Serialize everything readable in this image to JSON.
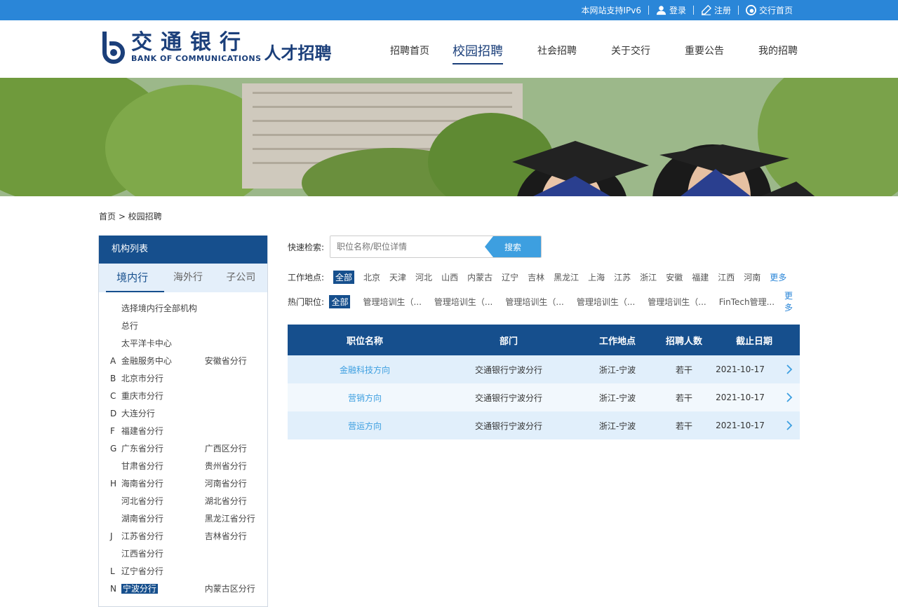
{
  "topbar": {
    "ipv6": "本网站支持IPv6",
    "login": "登录",
    "register": "注册",
    "home": "交行首页"
  },
  "brand": {
    "cn": "交通银行",
    "en": "BANK OF COMMUNICATIONS",
    "sub": "人才招聘"
  },
  "nav": [
    "招聘首页",
    "校园招聘",
    "社会招聘",
    "关于交行",
    "重要公告",
    "我的招聘"
  ],
  "breadcrumb": "首页 > 校园招聘",
  "sidebar": {
    "title": "机构列表",
    "tabs": [
      "境内行",
      "海外行",
      "子公司"
    ],
    "rows": [
      {
        "letter": "",
        "a": "选择境内行全部机构",
        "b": ""
      },
      {
        "letter": "",
        "a": "总行",
        "b": ""
      },
      {
        "letter": "",
        "a": "太平洋卡中心",
        "b": ""
      },
      {
        "letter": "A",
        "a": "金融服务中心",
        "b": "安徽省分行"
      },
      {
        "letter": "B",
        "a": "北京市分行",
        "b": ""
      },
      {
        "letter": "C",
        "a": "重庆市分行",
        "b": ""
      },
      {
        "letter": "D",
        "a": "大连分行",
        "b": ""
      },
      {
        "letter": "F",
        "a": "福建省分行",
        "b": ""
      },
      {
        "letter": "G",
        "a": "广东省分行",
        "b": "广西区分行"
      },
      {
        "letter": "",
        "a": "甘肃省分行",
        "b": "贵州省分行"
      },
      {
        "letter": "H",
        "a": "海南省分行",
        "b": "河南省分行"
      },
      {
        "letter": "",
        "a": "河北省分行",
        "b": "湖北省分行"
      },
      {
        "letter": "",
        "a": "湖南省分行",
        "b": "黑龙江省分行"
      },
      {
        "letter": "J",
        "a": "江苏省分行",
        "b": "吉林省分行"
      },
      {
        "letter": "",
        "a": "江西省分行",
        "b": ""
      },
      {
        "letter": "L",
        "a": "辽宁省分行",
        "b": ""
      },
      {
        "letter": "N",
        "a": "宁波分行",
        "b": "内蒙古区分行"
      }
    ]
  },
  "search": {
    "label": "快速检索:",
    "placeholder": "职位名称/职位详情",
    "button": "搜索"
  },
  "filters": {
    "location_label": "工作地点:",
    "locations": [
      "全部",
      "北京",
      "天津",
      "河北",
      "山西",
      "内蒙古",
      "辽宁",
      "吉林",
      "黑龙江",
      "上海",
      "江苏",
      "浙江",
      "安徽",
      "福建",
      "江西",
      "河南"
    ],
    "jobs_label": "热门职位:",
    "jobs": [
      "全部",
      "管理培训生（...",
      "管理培训生（...",
      "管理培训生（...",
      "管理培训生（...",
      "管理培训生（...",
      "FinTech管理..."
    ],
    "more": "更多"
  },
  "table": {
    "headers": [
      "职位名称",
      "部门",
      "工作地点",
      "招聘人数",
      "截止日期"
    ],
    "rows": [
      [
        "金融科技方向",
        "交通银行宁波分行",
        "浙江-宁波",
        "若干",
        "2021-10-17"
      ],
      [
        "营销方向",
        "交通银行宁波分行",
        "浙江-宁波",
        "若干",
        "2021-10-17"
      ],
      [
        "营运方向",
        "交通银行宁波分行",
        "浙江-宁波",
        "若干",
        "2021-10-17"
      ]
    ]
  },
  "colors": {
    "topbar": "#2a86d8",
    "primary": "#164f8d",
    "accent": "#3d9fe0",
    "row_light": "#e1effb"
  }
}
